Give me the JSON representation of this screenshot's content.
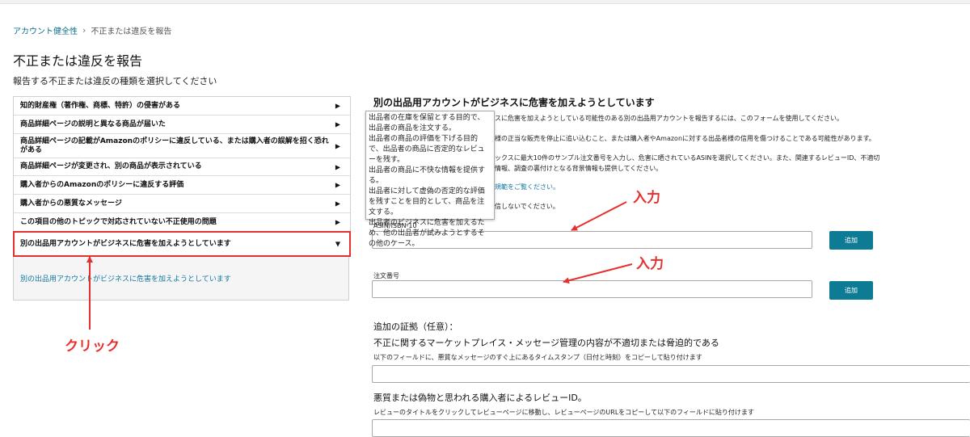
{
  "breadcrumb": {
    "home": "アカウント健全性",
    "separator": "›",
    "current": "不正または違反を報告"
  },
  "page": {
    "title": "不正または違反を報告",
    "subtitle": "報告する不正または違反の種類を選択してください"
  },
  "menu": {
    "items": [
      {
        "label": "知的財産権（著作権、商標、特許）の侵害がある",
        "arrow": "▶"
      },
      {
        "label": "商品詳細ページの説明と異なる商品が届いた",
        "arrow": "▶"
      },
      {
        "label": "商品詳細ページの記載がAmazonのポリシーに違反している、または購入者の誤解を招く恐れがある",
        "arrow": "▶"
      },
      {
        "label": "商品詳細ページが変更され、別の商品が表示されている",
        "arrow": "▶"
      },
      {
        "label": "購入者からのAmazonのポリシーに違反する評価",
        "arrow": "▶"
      },
      {
        "label": "購入者からの悪質なメッセージ",
        "arrow": "▶"
      },
      {
        "label": "この項目の他のトピックで対応されていない不正使用の問題",
        "arrow": "▶"
      },
      {
        "label": "別の出品用アカウントがビジネスに危害を加えようとしています",
        "arrow": "▼"
      }
    ],
    "selected_detail": "別の出品用アカウントがビジネスに危害を加えようとしています"
  },
  "tooltip": {
    "lines": [
      "出品者の在庫を保留とする目的で、出品者の商品を注文する。",
      "出品者の商品の評価を下げる目的で、出品者の商品に否定的なレビューを残す。",
      "出品者の商品に不快な情報を提供する。",
      "出品者に対して虚偽の否定的な評価を残すことを目的として、商品を注文する。",
      "出品者のビジネスに危害を加えるため、他の出品者が試みようとするその他のケース。"
    ]
  },
  "form": {
    "title": "別の出品用アカウントがビジネスに危害を加えようとしています",
    "desc1": "スに危害を加えようとしている可能性のある別の出品用アカウントを報告するには、このフォームを使用してください。",
    "desc2": "様の正当な販売を停止に追い込むこと、または購入者やAmazonに対する出品者様の信用を傷つけることである可能性があります。",
    "desc3": "ックスに最大10件のサンプル注文番号を入力し、危害に晒されているASINを選択してください。また、関連するレビューID、不適切",
    "desc4": "情報、調査の裏付けとなる背景情報も提供してください。",
    "desc5": "規範をご覧ください。",
    "desc6": "信しないでください。",
    "asin_label": "ASIN/ISBN-10",
    "asin_value": "",
    "add_label": "追加",
    "order_label": "注文番号",
    "order_value": "",
    "evidence_title": "追加の証拠（任意）：",
    "message_section_title": "不正に関するマーケットプレイス・メッセージ管理の内容が不適切または脅迫的である",
    "message_note": "以下のフィールドに、悪質なメッセージのすぐ上にあるタイムスタンプ（日付と時刻）をコピーして貼り付けます",
    "message_value": "",
    "review_section_title": "悪質または偽物と思われる購入者によるレビューID。",
    "review_note": "レビューのタイトルをクリックしてレビューページに移動し、レビューページのURLをコピーして以下のフィールドに貼り付けます",
    "review_value": ""
  },
  "annotations": {
    "input1": "入力",
    "input2": "入力",
    "click": "クリック",
    "color": "#e63030"
  },
  "colors": {
    "accent": "#0c7b93",
    "link": "#1276a0",
    "annotation": "#e63030"
  }
}
